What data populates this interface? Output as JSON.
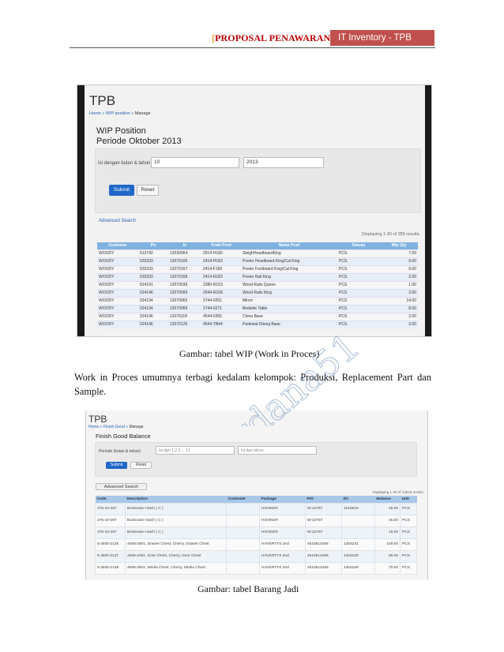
{
  "header": {
    "left_title": "PROPOSAL PENAWARAN",
    "left_open": "[",
    "left_close": "]",
    "right_label": "IT Inventory - TPB"
  },
  "shot1": {
    "app_title": "TPB",
    "breadcrumb_home": "Home",
    "breadcrumb_sep": "»",
    "breadcrumb_section": "WIP position",
    "breadcrumb_current": "Manage",
    "page_title": "WIP Position",
    "page_subtitle": "Periode Oktober 2013",
    "filter_label": "Isi dengan bulan & tahun",
    "month_value": "10",
    "year_value": "2013",
    "submit_label": "Submit",
    "reset_label": "Reset",
    "advanced_search": "Advanced Search",
    "displaying": "Displaying 1-30 of 355 results.",
    "columns": [
      "Customer",
      "Po",
      "Io",
      "Kode Prod",
      "Nama Prod",
      "Satuan",
      "Wip Qty"
    ],
    "rows": [
      [
        "WOODY",
        "513742",
        "12030064",
        "2914-H180",
        "SleighHeadboardKing",
        "PCS",
        "7.00"
      ],
      [
        "WOODY",
        "525333",
        "12070166",
        "2414-H183",
        "Poster Headboard King/Cal King",
        "PCS",
        "9.00"
      ],
      [
        "WOODY",
        "525333",
        "12070167",
        "2414-F183",
        "Poster Footboard King/Cal King",
        "PCS",
        "9.00"
      ],
      [
        "WOODY",
        "525333",
        "12070168",
        "2414-R183",
        "Poster Rail King",
        "PCS",
        "2.00"
      ],
      [
        "WOODY",
        "524191",
        "12070039",
        "2380-R153",
        "Wood Rails Queen",
        "PCS",
        "1.00"
      ],
      [
        "WOODY",
        "524146",
        "12070099",
        "2544-R168",
        "Wood Rails King",
        "PCS",
        "3.00"
      ],
      [
        "WOODY",
        "524134",
        "12070065",
        "2744-0251",
        "Mirror",
        "PCS",
        "14.00"
      ],
      [
        "WOODY",
        "524134",
        "12070069",
        "2744-0271",
        "Bedside Table",
        "PCS",
        "8.00"
      ],
      [
        "WOODY",
        "524146",
        "12070118",
        "4544-0355",
        "China Base",
        "PCS",
        "3.00"
      ],
      [
        "WOODY",
        "524146",
        "12070126",
        "4544-TB44",
        "Pedestal Dining Base",
        "PCS",
        "3.00"
      ]
    ]
  },
  "caption1": "Gambar: tabel WIP (Work in Proces)",
  "paragraph": "Work in Proces umumnya terbagi kedalam kelompok: Produksi, Replacement Part dan Sample.",
  "shot2": {
    "app_title": "TPB",
    "breadcrumb_home": "Home",
    "breadcrumb_sep": "»",
    "breadcrumb_section": "Finish Good",
    "breadcrumb_current": "Manage",
    "page_title": "Finish Good Balance",
    "filter_label": "Periode (bulan & tahun)",
    "month_placeholder": "Isi dgn 1,2,3 ... 12",
    "year_placeholder": "Isi dgn tahun",
    "submit_label": "Submit",
    "reset_label": "Reset",
    "advanced_search": "Advanced Search",
    "displaying": "Displaying 1-30 of 13615 results.",
    "columns": [
      "Code",
      "Description",
      "Customer",
      "Package",
      "P/O",
      "I/O",
      "Balance",
      "Unit"
    ],
    "rows": [
      [
        "375-10-267",
        "Bookcase Hutch ( C )",
        "",
        "HOOKER",
        "W-22787",
        "1215619",
        "45.00",
        "PCS"
      ],
      [
        "375-10-267",
        "Bookcase Hutch ( C )",
        "",
        "HOOKER",
        "W-22787",
        "",
        "45.00",
        "PCS"
      ],
      [
        "375-10-267",
        "Bookcase Hutch ( C )",
        "",
        "HOOKER",
        "W-22787",
        "",
        "15.00",
        "PCS"
      ],
      [
        "5-4500-2136",
        "4568-2801, Drawer Chest, Cherry, Drawer Chest",
        "",
        "HAVERTYS 2nd",
        "4510514366",
        "1304231",
        "100.00",
        "PCS"
      ],
      [
        "5-4500-2137",
        "4568-2451, Door Chest, Cherry, Door Chest",
        "",
        "HAVERTYS 2nd",
        "4510514366",
        "1304230",
        "69.00",
        "PCS"
      ],
      [
        "5-4500-2138",
        "4568-2801, Media Chest, Cherry, Media Chest",
        "",
        "HAVERTYS 2nd",
        "4510514365",
        "1304229",
        "70.00",
        "PCS"
      ]
    ]
  },
  "caption2": "Gambar: tabel Barang Jadi",
  "watermark": "srdana51"
}
